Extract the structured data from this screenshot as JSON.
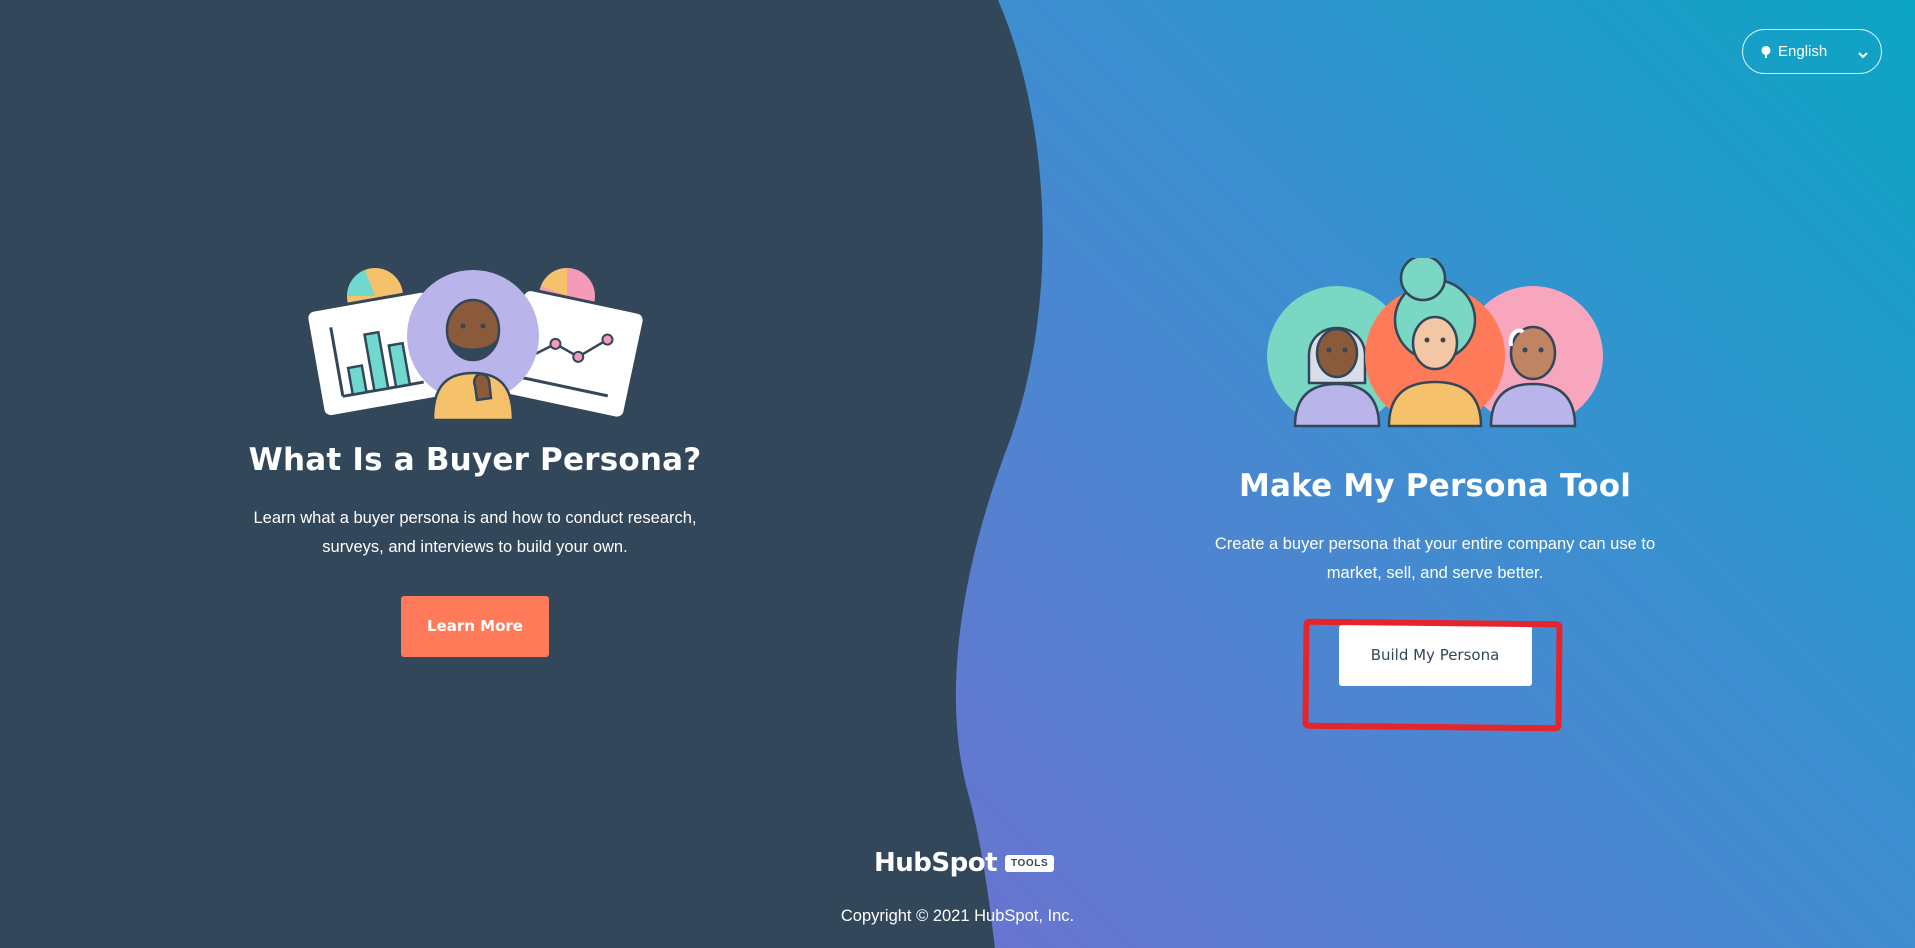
{
  "language": {
    "label": "English"
  },
  "left_panel": {
    "title": "What Is a Buyer Persona?",
    "description": "Learn what a buyer persona is and how to conduct research, surveys, and interviews to build your own.",
    "button_label": "Learn More"
  },
  "right_panel": {
    "title": "Make My Persona Tool",
    "description": "Create a buyer persona that your entire company can use to market, sell, and serve better.",
    "button_label": "Build My Persona"
  },
  "footer": {
    "logo_text": "HubSpot",
    "badge": "TOOLS",
    "copyright": "Copyright © 2021 HubSpot, Inc."
  },
  "colors": {
    "dark_bg": "#33475b",
    "gradient_top": "#0fa2c5",
    "gradient_bottom": "#6a78d1",
    "accent_orange": "#ff7a59",
    "highlight_red": "#e5242b"
  }
}
